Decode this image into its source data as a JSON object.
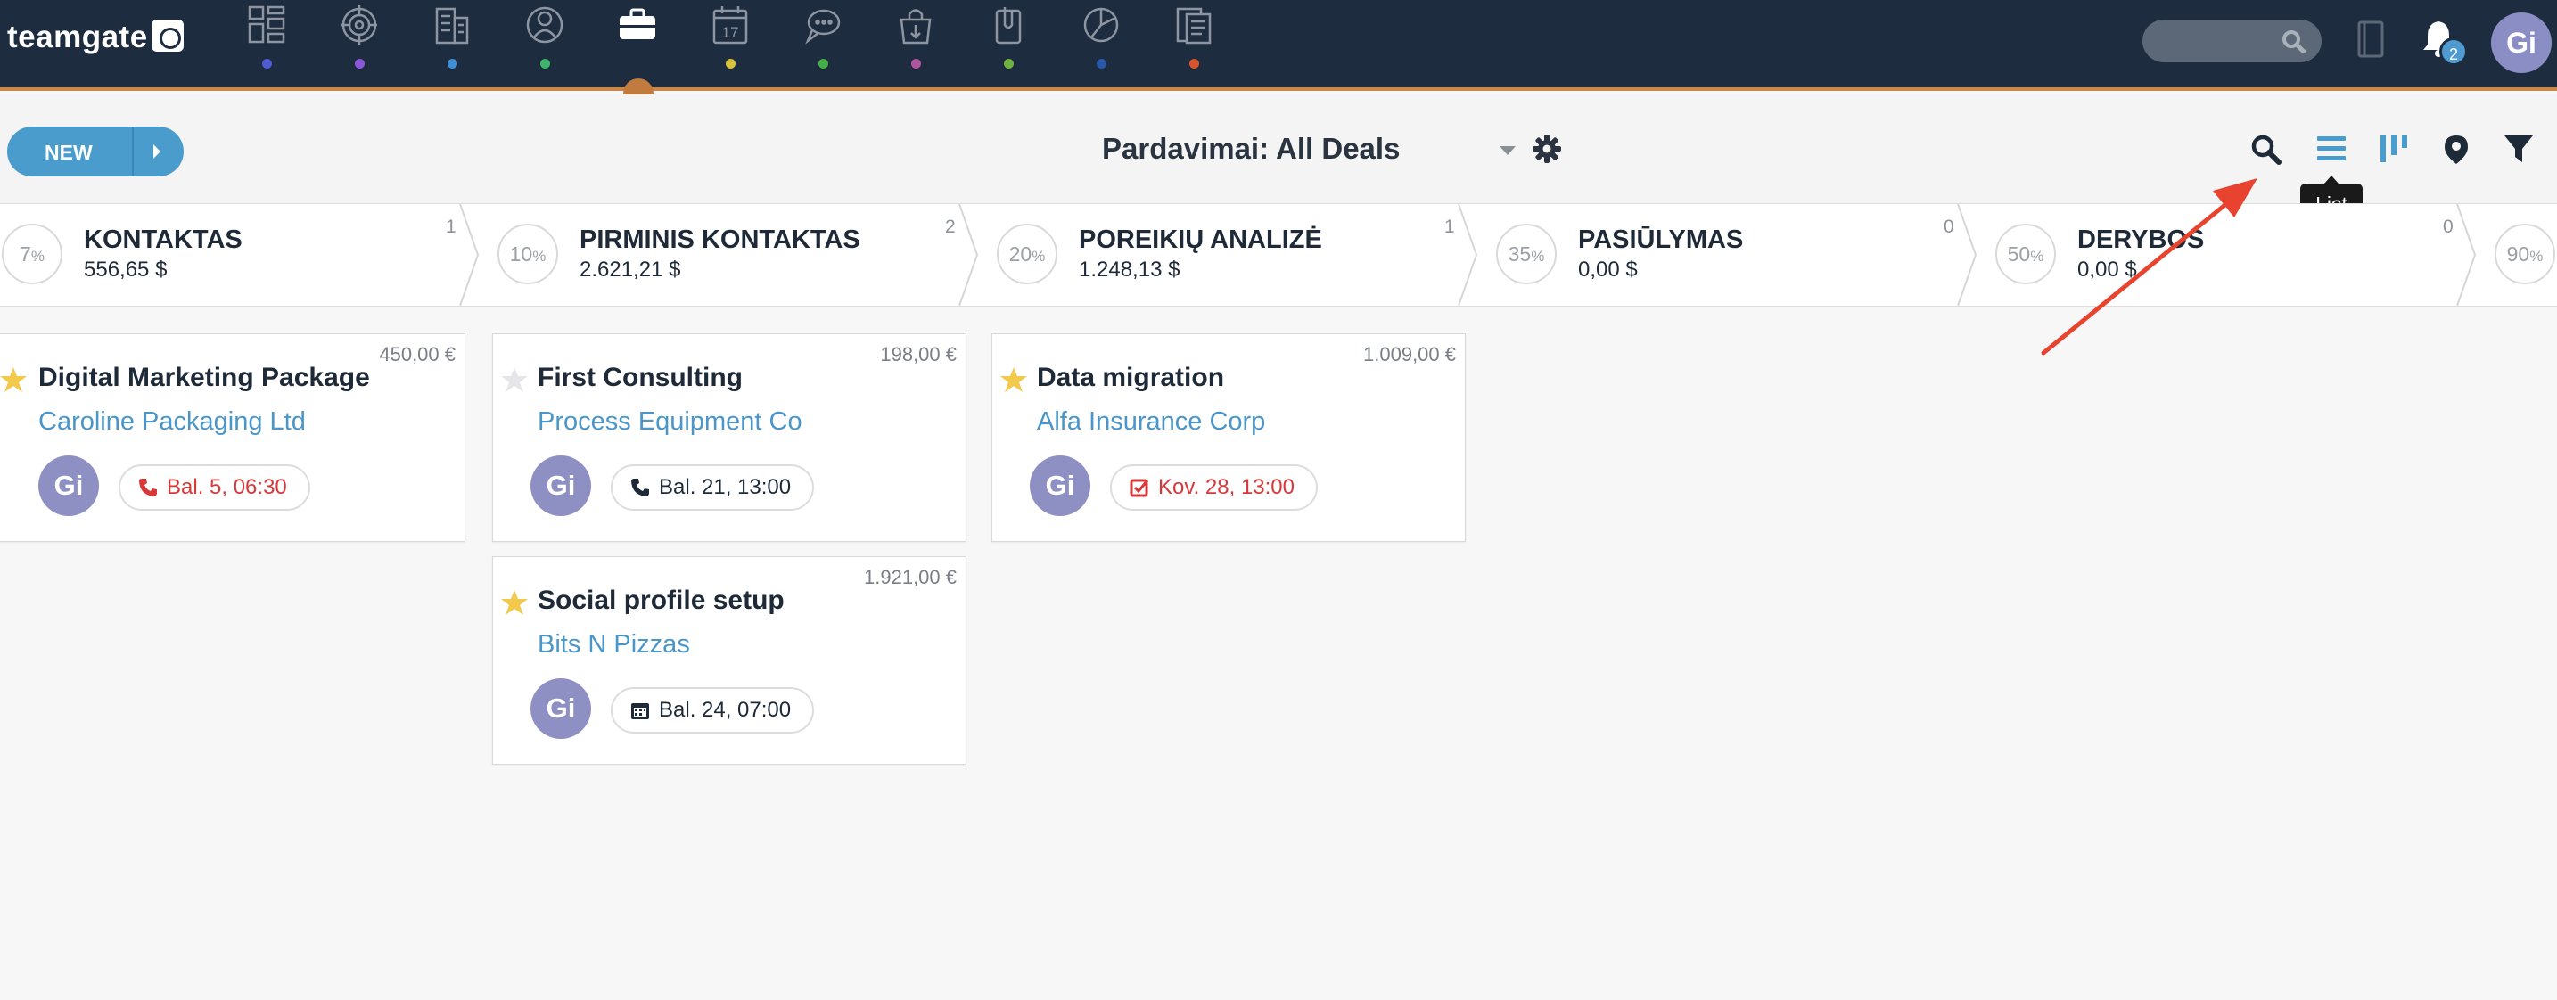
{
  "app": {
    "logo_text": "teamgate"
  },
  "nav": {
    "items": [
      {
        "icon": "dashboard-icon",
        "dot_color": "#4f5bd5"
      },
      {
        "icon": "target-icon",
        "dot_color": "#8b57d8"
      },
      {
        "icon": "building-icon",
        "dot_color": "#3f8fd6"
      },
      {
        "icon": "contacts-icon",
        "dot_color": "#40b36a"
      },
      {
        "icon": "briefcase-icon",
        "dot_color": "#c17b3f",
        "active": true
      },
      {
        "icon": "calendar-icon",
        "dot_color": "#d8c33a",
        "label": "17"
      },
      {
        "icon": "chat-icon",
        "dot_color": "#43b043"
      },
      {
        "icon": "bag-icon",
        "dot_color": "#b0549f"
      },
      {
        "icon": "attachment-icon",
        "dot_color": "#6fb33e"
      },
      {
        "icon": "pie-chart-icon",
        "dot_color": "#2b57a8"
      },
      {
        "icon": "report-icon",
        "dot_color": "#d8552c"
      }
    ],
    "notifications_count": "2",
    "user_initials": "Gi"
  },
  "toolbar": {
    "new_label": "NEW",
    "view_title": "Pardavimai: All Deals",
    "tooltip": "List"
  },
  "stages": [
    {
      "percent": "7",
      "name": "KONTAKTAS",
      "amount": "556,65 $",
      "count": "1"
    },
    {
      "percent": "10",
      "name": "PIRMINIS KONTAKTAS",
      "amount": "2.621,21 $",
      "count": "2"
    },
    {
      "percent": "20",
      "name": "POREIKIŲ ANALIZĖ",
      "amount": "1.248,13 $",
      "count": "1"
    },
    {
      "percent": "35",
      "name": "PASIŪLYMAS",
      "amount": "0,00 $",
      "count": "0"
    },
    {
      "percent": "50",
      "name": "DERYBOS",
      "amount": "0,00 $",
      "count": "0"
    },
    {
      "percent": "90",
      "name": "",
      "amount": "",
      "count": ""
    }
  ],
  "percent_sign": "%",
  "deals": [
    {
      "title": "Digital Marketing Package",
      "company": "Caroline Packaging Ltd",
      "value": "450,00 €",
      "starred": true,
      "owner": "Gi",
      "activity": "Bal. 5, 06:30",
      "activity_icon": "phone-icon",
      "activity_color": "#d9383a"
    },
    {
      "title": "First Consulting",
      "company": "Process Equipment Co",
      "value": "198,00 €",
      "starred": false,
      "owner": "Gi",
      "activity": "Bal. 21, 13:00",
      "activity_icon": "phone-icon",
      "activity_color": "#1f2a38"
    },
    {
      "title": "Social profile setup",
      "company": "Bits N Pizzas",
      "value": "1.921,00 €",
      "starred": true,
      "owner": "Gi",
      "activity": "Bal. 24, 07:00",
      "activity_icon": "calendar-icon",
      "activity_color": "#1f2a38"
    },
    {
      "title": "Data migration",
      "company": "Alfa Insurance Corp",
      "value": "1.009,00 €",
      "starred": true,
      "owner": "Gi",
      "activity": "Kov. 28, 13:00",
      "activity_icon": "task-check-icon",
      "activity_color": "#d9383a"
    }
  ],
  "colors": {
    "nav_bg": "#1e2c3f",
    "accent": "#4a9ccc",
    "link": "#4a96c8",
    "overdue": "#d9383a",
    "star": "#f2c94c",
    "annotation_arrow": "#e8432e"
  }
}
